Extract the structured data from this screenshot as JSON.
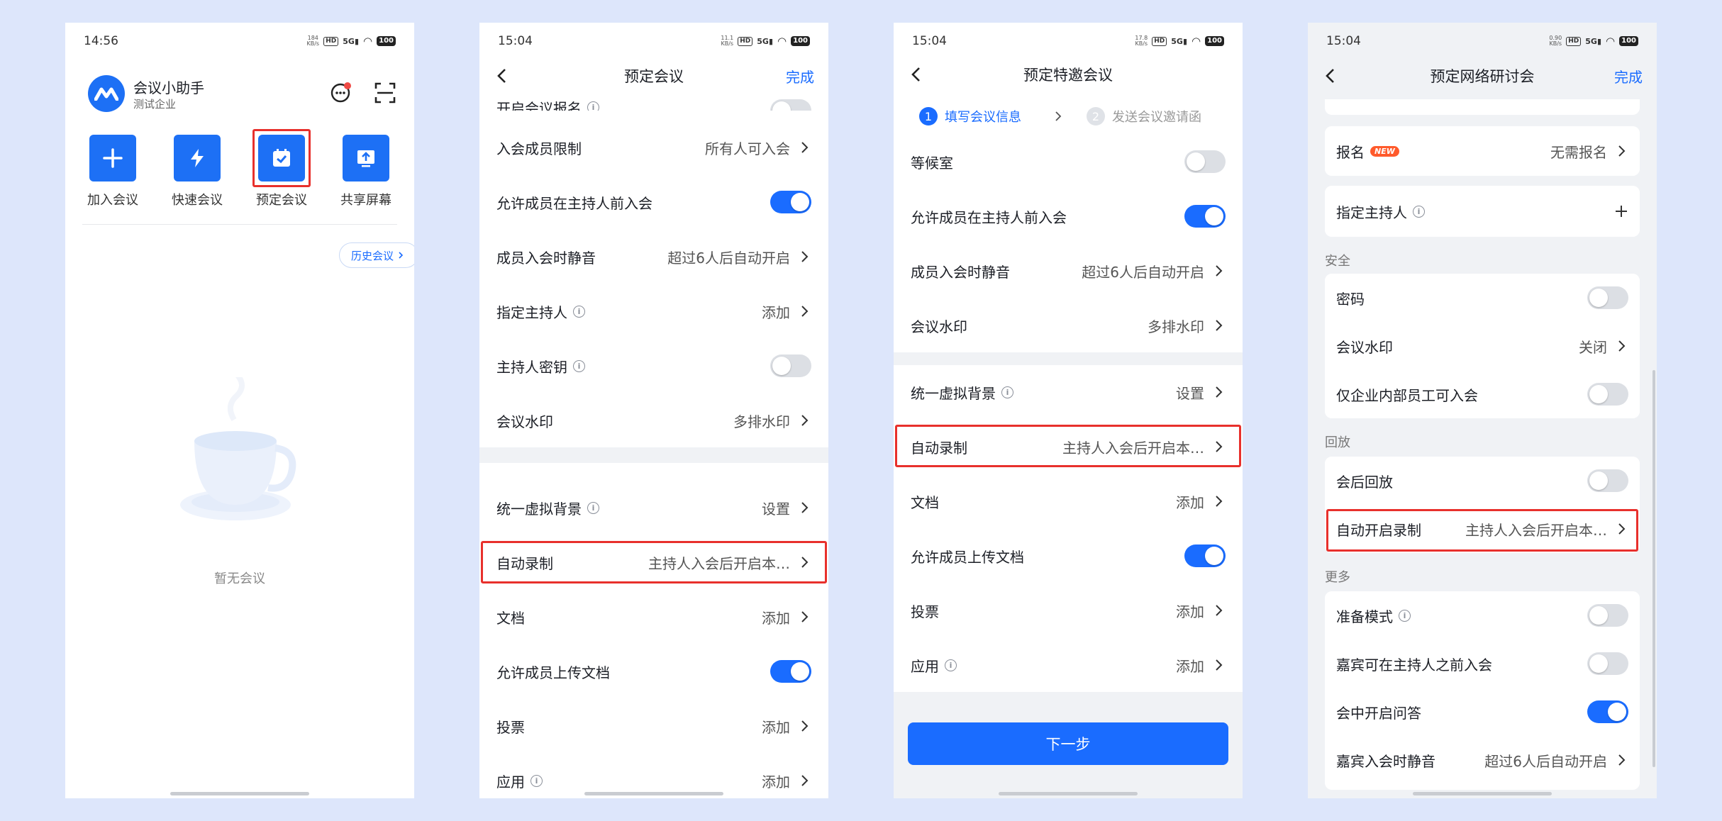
{
  "colors": {
    "accent": "#1a6cff",
    "highlight": "#e8302c",
    "background": "#dde6fb"
  },
  "screen1": {
    "status_time": "14:56",
    "status_net": "184\nKB/s",
    "app_name": "会议小助手",
    "org_name": "测试企业",
    "actions": [
      {
        "label": "加入会议",
        "icon": "plus-icon"
      },
      {
        "label": "快速会议",
        "icon": "lightning-icon"
      },
      {
        "label": "预定会议",
        "icon": "calendar-check-icon"
      },
      {
        "label": "共享屏幕",
        "icon": "share-screen-icon"
      }
    ],
    "history_label": "历史会议",
    "empty_text": "暂无会议"
  },
  "screen2": {
    "status_time": "15:04",
    "status_net": "11.1\nKB/s",
    "title": "预定会议",
    "done": "完成",
    "partial_row": "开启会议报名",
    "rows": [
      {
        "label": "入会成员限制",
        "value": "所有人可入会"
      },
      {
        "label": "允许成员在主持人前入会",
        "toggle": true
      },
      {
        "label": "成员入会时静音",
        "value": "超过6人后自动开启"
      },
      {
        "label": "指定主持人",
        "value": "添加",
        "info": true
      },
      {
        "label": "主持人密钥",
        "toggle": false,
        "info": true
      },
      {
        "label": "会议水印",
        "value": "多排水印"
      },
      {
        "label": "统一虚拟背景",
        "value": "设置",
        "info": true
      },
      {
        "label": "自动录制",
        "value": "主持人入会后开启本…"
      },
      {
        "label": "文档",
        "value": "添加"
      },
      {
        "label": "允许成员上传文档",
        "toggle": true
      },
      {
        "label": "投票",
        "value": "添加"
      },
      {
        "label": "应用",
        "value": "添加",
        "info": true
      }
    ]
  },
  "screen3": {
    "status_time": "15:04",
    "status_net": "17.8\nKB/s",
    "title": "预定特邀会议",
    "step1_num": "1",
    "step1_label": "填写会议信息",
    "step2_num": "2",
    "step2_label": "发送会议邀请函",
    "rows": [
      {
        "label": "等候室",
        "toggle": false
      },
      {
        "label": "允许成员在主持人前入会",
        "toggle": true
      },
      {
        "label": "成员入会时静音",
        "value": "超过6人后自动开启"
      },
      {
        "label": "会议水印",
        "value": "多排水印"
      },
      {
        "label": "统一虚拟背景",
        "value": "设置",
        "info": true
      },
      {
        "label": "自动录制",
        "value": "主持人入会后开启本…"
      },
      {
        "label": "文档",
        "value": "添加"
      },
      {
        "label": "允许成员上传文档",
        "toggle": true
      },
      {
        "label": "投票",
        "value": "添加"
      },
      {
        "label": "应用",
        "value": "添加",
        "info": true
      }
    ],
    "next_button": "下一步"
  },
  "screen4": {
    "status_time": "15:04",
    "status_net": "0.90\nKB/s",
    "title": "预定网络研讨会",
    "done": "完成",
    "signup_label": "报名",
    "new_badge": "NEW",
    "signup_value": "无需报名",
    "host_label": "指定主持人",
    "sec_security": "安全",
    "password_label": "密码",
    "watermark_label": "会议水印",
    "watermark_value": "关闭",
    "internal_only_label": "仅企业内部员工可入会",
    "sec_playback": "回放",
    "playback_label": "会后回放",
    "autorec_label": "自动开启录制",
    "autorec_value": "主持人入会后开启本…",
    "sec_more": "更多",
    "prep_label": "准备模式",
    "guest_before_label": "嘉宾可在主持人之前入会",
    "qa_label": "会中开启问答",
    "guest_mute_label": "嘉宾入会时静音",
    "guest_mute_value": "超过6人后自动开启"
  }
}
